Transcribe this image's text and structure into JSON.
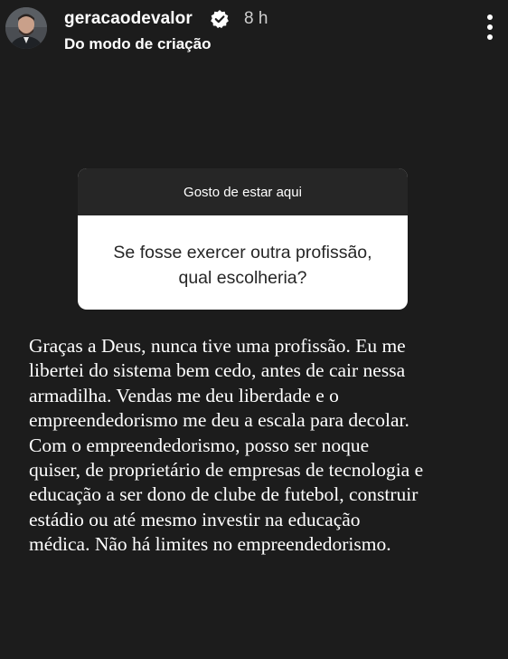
{
  "header": {
    "username": "geracaodevalor",
    "time": "8 h",
    "subtitle": "Do modo de criação",
    "verified_icon": "verified-badge-icon",
    "more_icon": "more-vertical-icon"
  },
  "sticker": {
    "header": "Gosto de estar aqui",
    "question_lines": [
      "Se fosse exercer outra profissão,",
      "qual escolheria?"
    ]
  },
  "answer": {
    "lines": [
      "Graças a Deus, nunca tive uma profissão. Eu me",
      "libertei do sistema bem cedo, antes de cair nessa",
      "armadilha. Vendas me deu liberdade e o",
      "empreendedorismo me deu a escala para decolar.",
      "Com o empreendedorismo, posso ser noque",
      "quiser, de proprietário de empresas de tecnologia e",
      "educação a ser dono de clube de futebol, construir",
      "estádio ou até mesmo investir na educação",
      "médica. Não há limites no empreendedorismo."
    ]
  },
  "colors": {
    "background": "#1c1c1c",
    "sticker_header_bg": "#262626",
    "sticker_body_bg": "#ffffff",
    "text": "#ffffff"
  }
}
